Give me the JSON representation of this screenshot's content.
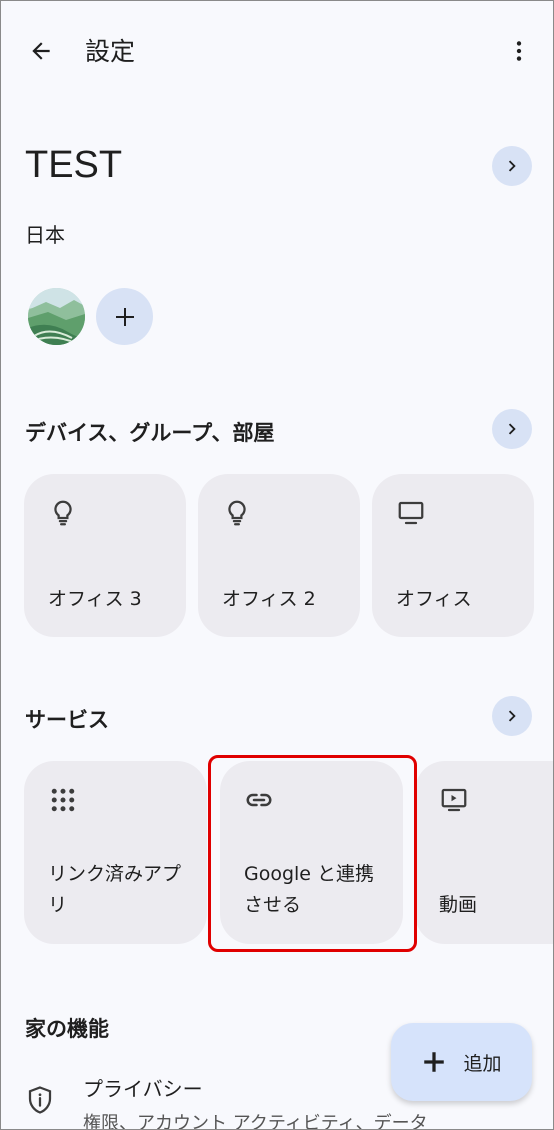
{
  "header": {
    "title": "設定"
  },
  "home": {
    "name": "TEST",
    "location": "日本"
  },
  "devices_section": {
    "title": "デバイス、グループ、部屋",
    "cards": [
      {
        "label": "オフィス 3",
        "icon": "lightbulb-icon"
      },
      {
        "label": "オフィス 2",
        "icon": "lightbulb-icon"
      },
      {
        "label": "オフィス",
        "icon": "tv-icon"
      }
    ]
  },
  "services_section": {
    "title": "サービス",
    "cards": [
      {
        "label_line1": "リンク済みアプ",
        "label_line2": "リ",
        "icon": "apps-grid-icon"
      },
      {
        "label_line1": "Google と連携",
        "label_line2": "させる",
        "icon": "link-icon"
      },
      {
        "label_line1": "動画",
        "label_line2": "",
        "icon": "video-icon"
      }
    ]
  },
  "features_section": {
    "title": "家の機能",
    "items": [
      {
        "title": "プライバシー",
        "subtitle": "権限、アカウント アクティビティ、データ",
        "icon": "shield-info-icon"
      }
    ]
  },
  "fab": {
    "label": "追加"
  },
  "colors": {
    "background": "#f8f9fd",
    "card": "#ecebf0",
    "accent_button": "#d8e2f5",
    "fab": "#d6e3fb",
    "highlight": "#e00000"
  }
}
